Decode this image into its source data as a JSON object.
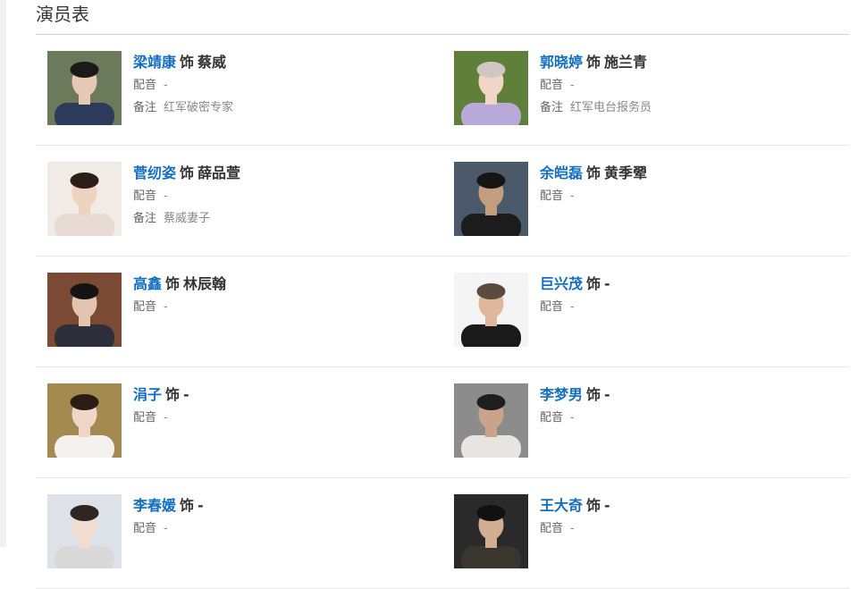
{
  "section": {
    "title": "演员表"
  },
  "cast": [
    {
      "actor": "梁靖康",
      "sep": "饰",
      "role": "蔡威",
      "dub_label": "配音",
      "dub_value": "-",
      "note_label": "备注",
      "note_value": "红军破密专家",
      "photo": {
        "bg": "#6b7a5a",
        "hair": "#1c1a18",
        "skin": "#e6c9b4",
        "cloth": "#2c3a5c"
      }
    },
    {
      "actor": "郭晓婷",
      "sep": "饰",
      "role": "施兰青",
      "dub_label": "配音",
      "dub_value": "-",
      "note_label": "备注",
      "note_value": "红军电台报务员",
      "photo": {
        "bg": "#5f7f3a",
        "hair": "#cfc7c2",
        "skin": "#f1d6c8",
        "cloth": "#b9a9d8"
      }
    },
    {
      "actor": "菅纫姿",
      "sep": "饰",
      "role": "薛品萱",
      "dub_label": "配音",
      "dub_value": "-",
      "note_label": "备注",
      "note_value": "蔡威妻子",
      "photo": {
        "bg": "#f1ebe6",
        "hair": "#2b1f1a",
        "skin": "#efd2c0",
        "cloth": "#e7dbd3"
      }
    },
    {
      "actor": "余皑磊",
      "sep": "饰",
      "role": "黄季翚",
      "dub_label": "配音",
      "dub_value": "-",
      "photo": {
        "bg": "#4b5a6a",
        "hair": "#151515",
        "skin": "#c49c7e",
        "cloth": "#1c1c1c"
      }
    },
    {
      "actor": "高鑫",
      "sep": "饰",
      "role": "林辰翰",
      "dub_label": "配音",
      "dub_value": "-",
      "photo": {
        "bg": "#7a4a34",
        "hair": "#141414",
        "skin": "#e3c4ae",
        "cloth": "#2d2f3a"
      }
    },
    {
      "actor": "巨兴茂",
      "sep": "饰",
      "role": "-",
      "dub_label": "配音",
      "dub_value": "-",
      "photo": {
        "bg": "#f4f4f4",
        "hair": "#5a4a40",
        "skin": "#e0b79b",
        "cloth": "#1a1a1a"
      }
    },
    {
      "actor": "涓子",
      "sep": "饰",
      "role": "-",
      "dub_label": "配音",
      "dub_value": "-",
      "photo": {
        "bg": "#a48a4e",
        "hair": "#2a1d16",
        "skin": "#f0d6c6",
        "cloth": "#f4f1ee"
      }
    },
    {
      "actor": "李梦男",
      "sep": "饰",
      "role": "-",
      "dub_label": "配音",
      "dub_value": "-",
      "photo": {
        "bg": "#8c8c8c",
        "hair": "#1e1e1e",
        "skin": "#c9a48a",
        "cloth": "#e8e4e0"
      }
    },
    {
      "actor": "李春媛",
      "sep": "饰",
      "role": "-",
      "dub_label": "配音",
      "dub_value": "-",
      "photo": {
        "bg": "#dde2e8",
        "hair": "#2e2620",
        "skin": "#f2dcd0",
        "cloth": "#d9d9d9"
      }
    },
    {
      "actor": "王大奇",
      "sep": "饰",
      "role": "-",
      "dub_label": "配音",
      "dub_value": "-",
      "photo": {
        "bg": "#2a2a2a",
        "hair": "#111111",
        "skin": "#d2ad92",
        "cloth": "#3a352e"
      }
    }
  ]
}
